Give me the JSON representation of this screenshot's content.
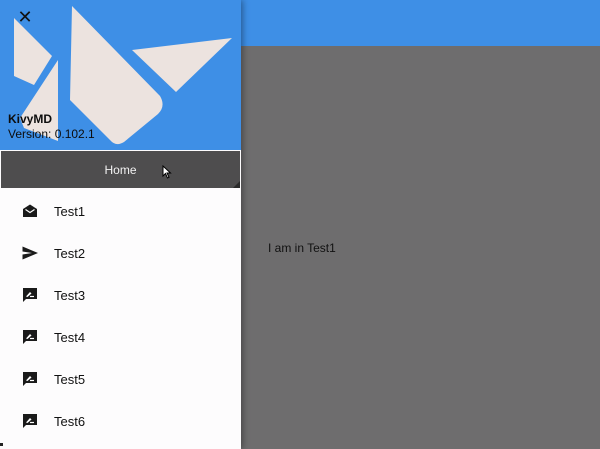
{
  "drawer": {
    "close_icon": "close-icon",
    "app_name": "KivyMD",
    "app_version": "Version: 0.102.1",
    "home_label": "Home",
    "items": [
      {
        "label": "Test1",
        "icon": "email-open-icon"
      },
      {
        "label": "Test2",
        "icon": "send-icon"
      },
      {
        "label": "Test3",
        "icon": "message-draw-icon"
      },
      {
        "label": "Test4",
        "icon": "message-draw-icon"
      },
      {
        "label": "Test5",
        "icon": "message-draw-icon"
      },
      {
        "label": "Test6",
        "icon": "message-draw-icon"
      }
    ]
  },
  "content": {
    "text": "I am in Test1"
  },
  "colors": {
    "primary": "#3e8fe6",
    "home_button": "#4e4d4e",
    "content_bg": "#6e6d6e",
    "drawer_bg": "#fdfcfd"
  }
}
